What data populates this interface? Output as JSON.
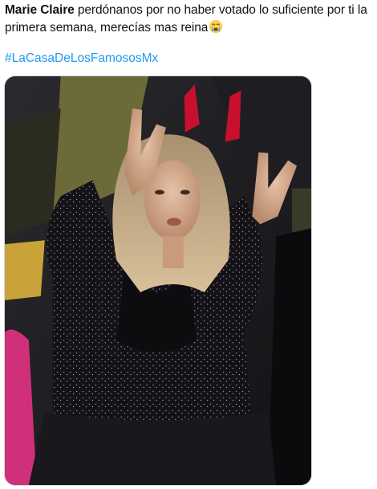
{
  "tweet": {
    "author_mention": "Marie Claire",
    "body_line_1": " perdónanos por no haber votado lo suficiente por ti la",
    "body_line_2": "primera semana, merecías mas reina",
    "emoji": "loudly-crying-face",
    "hashtag": "#LaCasaDeLosFamososMx"
  },
  "media": {
    "description_icon": "photo",
    "accent_colors": {
      "horns": "#c8102e",
      "outfit": "#141216",
      "sofa": "#d0307a",
      "link": "#1d9bf0"
    }
  }
}
